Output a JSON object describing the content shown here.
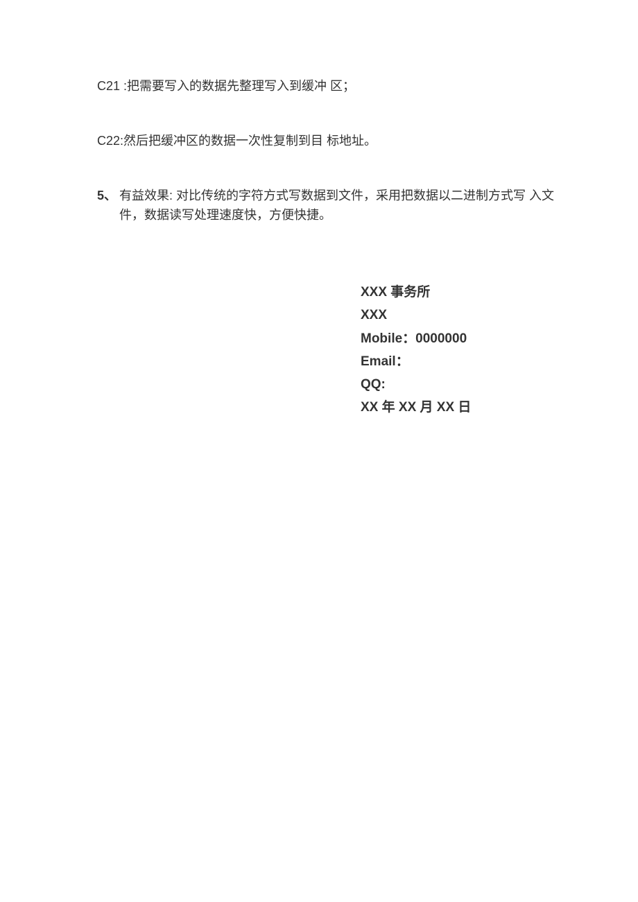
{
  "paragraphs": {
    "c21": "C21 :把需要写入的数据先整理写入到缓冲 区；",
    "c22": "C22:然后把缓冲区的数据一次性复制到目 标地址。"
  },
  "item5": {
    "label": "5、",
    "text": "有益效果: 对比传统的字符方式写数据到文件，采用把数据以二进制方式写 入文件，数据读写处理速度快，方便快捷。"
  },
  "signature": {
    "firm": "XXX 事务所",
    "name": "XXX",
    "mobile": "Mobile：0000000",
    "email": "Email：",
    "qq": "QQ:",
    "date": "XX 年 XX 月 XX 日"
  }
}
